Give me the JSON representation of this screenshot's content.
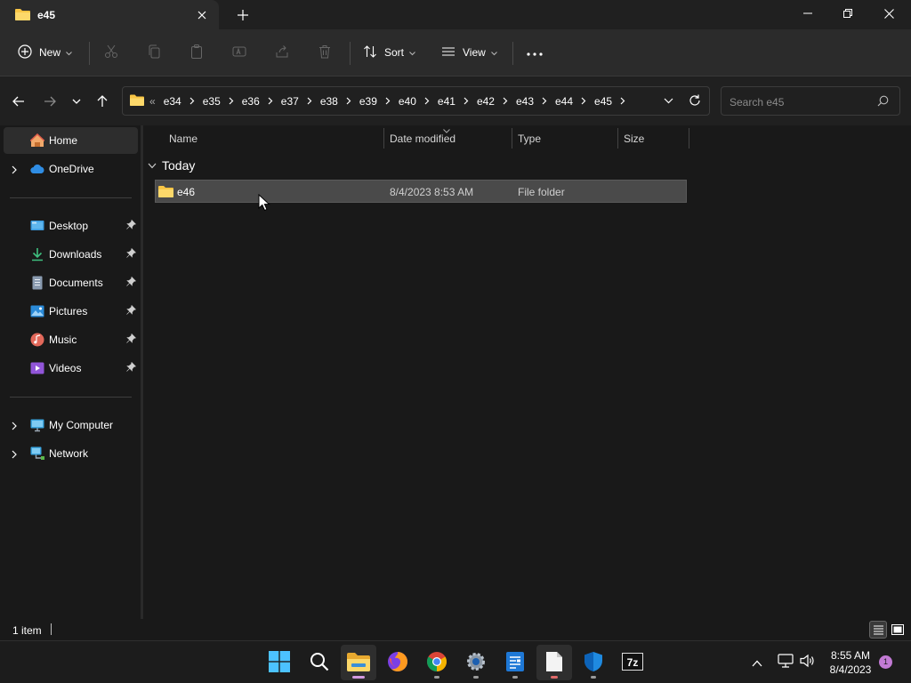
{
  "window": {
    "tab_title": "e45",
    "tab_icon": "folder-icon",
    "new_tab_label": "+"
  },
  "toolbar": {
    "new_label": "New",
    "sort_label": "Sort",
    "view_label": "View",
    "more_label": "···"
  },
  "address": {
    "overflow": "«",
    "crumbs": [
      "e34",
      "e35",
      "e36",
      "e37",
      "e38",
      "e39",
      "e40",
      "e41",
      "e42",
      "e43",
      "e44",
      "e45"
    ]
  },
  "search": {
    "placeholder": "Search e45"
  },
  "sidebar": {
    "home": "Home",
    "onedrive": "OneDrive",
    "desktop": "Desktop",
    "downloads": "Downloads",
    "documents": "Documents",
    "pictures": "Pictures",
    "music": "Music",
    "videos": "Videos",
    "my_computer": "My Computer",
    "network": "Network"
  },
  "columns": {
    "name": "Name",
    "date_modified": "Date modified",
    "type": "Type",
    "size": "Size"
  },
  "group": {
    "label": "Today"
  },
  "files": [
    {
      "name": "e46",
      "date_modified": "8/4/2023 8:53 AM",
      "type": "File folder",
      "size": ""
    }
  ],
  "status": {
    "item_count": "1 item"
  },
  "taskbar": {
    "time": "8:55 AM",
    "date": "8/4/2023",
    "notification_count": "1"
  },
  "colors": {
    "accent_folder": "#f8c545",
    "selection": "#4a4a4a",
    "active_indicator": "#d39be0"
  }
}
